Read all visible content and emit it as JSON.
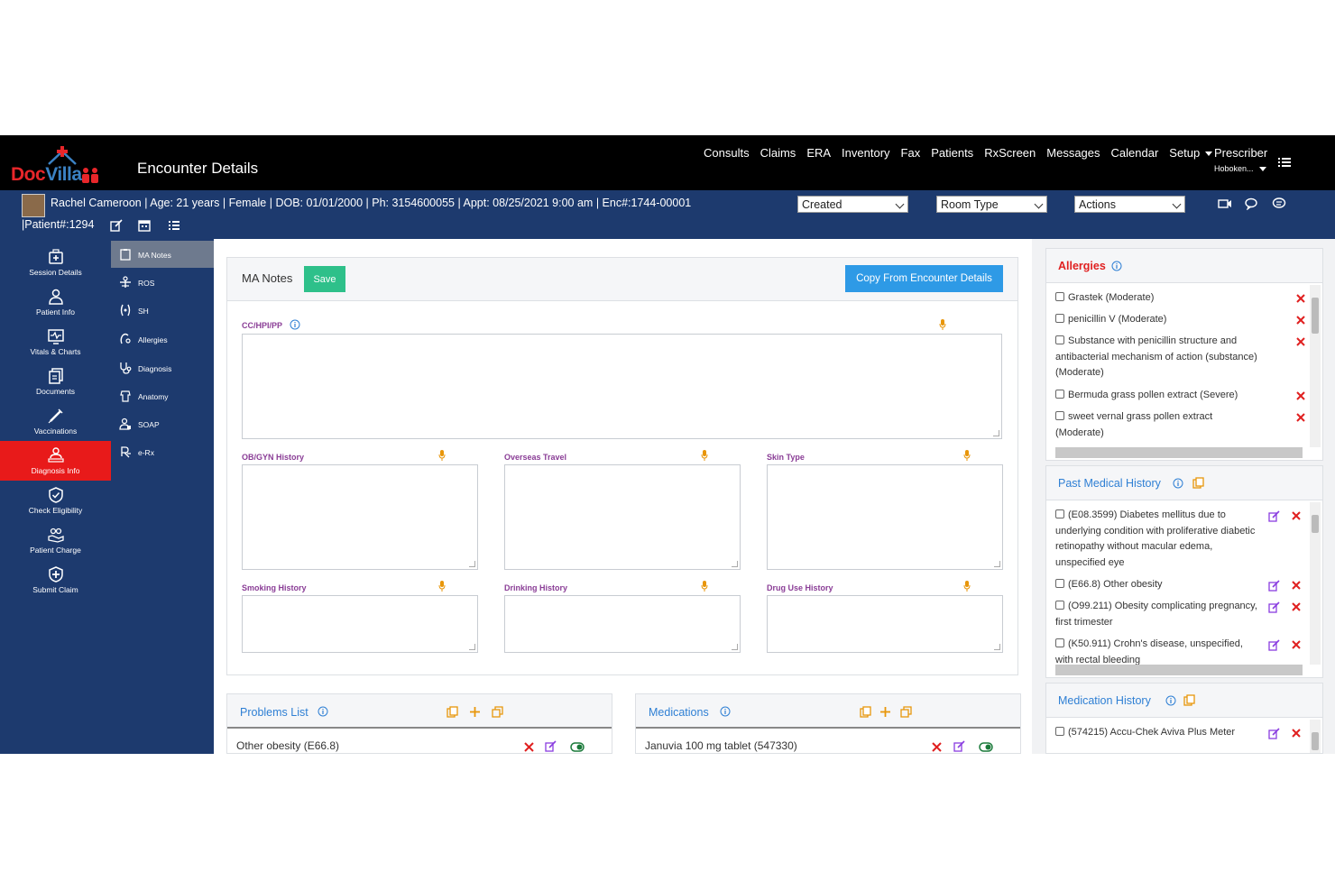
{
  "app": {
    "logo_doc": "Doc",
    "logo_villa": "Villa",
    "page_title": "Encounter Details"
  },
  "nav": {
    "links": [
      "Consults",
      "Claims",
      "ERA",
      "Inventory",
      "Fax",
      "Patients",
      "RxScreen",
      "Messages",
      "Calendar"
    ],
    "setup": "Setup",
    "prescriber": "Prescriber",
    "location": "Hoboken..."
  },
  "patient": {
    "info": "Rachel Cameroon | Age: 21 years | Female | DOB: 01/01/2000 | Ph: 3154600055 | Appt: 08/25/2021 9:00 am | Enc#:1744-00001",
    "patient_num": "|Patient#:1294",
    "status_select": "Created",
    "room_select": "Room Type",
    "actions_select": "Actions"
  },
  "sidebar": {
    "items": [
      "Session Details",
      "Patient Info",
      "Vitals & Charts",
      "Documents",
      "Vaccinations",
      "Diagnosis Info",
      "Check Eligibility",
      "Patient Charge",
      "Submit Claim"
    ]
  },
  "subsidebar": {
    "items": [
      "MA Notes",
      "ROS",
      "SH",
      "Allergies",
      "Diagnosis",
      "Anatomy",
      "SOAP",
      "e-Rx"
    ]
  },
  "ma_notes": {
    "title": "MA Notes",
    "save": "Save",
    "copy": "Copy From Encounter Details",
    "fields": {
      "cc": "CC/HPI/PP",
      "obgyn": "OB/GYN History",
      "overseas": "Overseas Travel",
      "skin": "Skin Type",
      "smoking": "Smoking History",
      "drinking": "Drinking History",
      "drug": "Drug Use History"
    }
  },
  "problems": {
    "title": "Problems List",
    "row": "Other obesity (E66.8)"
  },
  "medications": {
    "title": "Medications",
    "row": "Januvia 100 mg tablet (547330)"
  },
  "allergies": {
    "title": "Allergies",
    "items": [
      "Grastek (Moderate)",
      "penicillin V (Moderate)",
      "Substance with penicillin structure and antibacterial mechanism of action (substance) (Moderate)",
      "Bermuda grass pollen extract (Severe)",
      "sweet vernal grass pollen extract (Moderate)"
    ]
  },
  "pmh": {
    "title": "Past Medical History",
    "items": [
      "(E08.3599) Diabetes mellitus due to underlying condition with proliferative diabetic retinopathy without macular edema, unspecified eye",
      "(E66.8) Other obesity",
      "(O99.211) Obesity complicating pregnancy, first trimester",
      "(K50.911) Crohn's disease, unspecified, with rectal bleeding"
    ]
  },
  "medhist": {
    "title": "Medication History",
    "items": [
      "(574215) Accu-Chek Aviva Plus Meter"
    ]
  },
  "colors": {
    "navy": "#1d3a6e",
    "active_red": "#e81a1a",
    "accent_blue": "#2e7fd4",
    "save_green": "#2ec08a",
    "label_purple": "#8a3d96",
    "allergy_red": "#e02020"
  }
}
